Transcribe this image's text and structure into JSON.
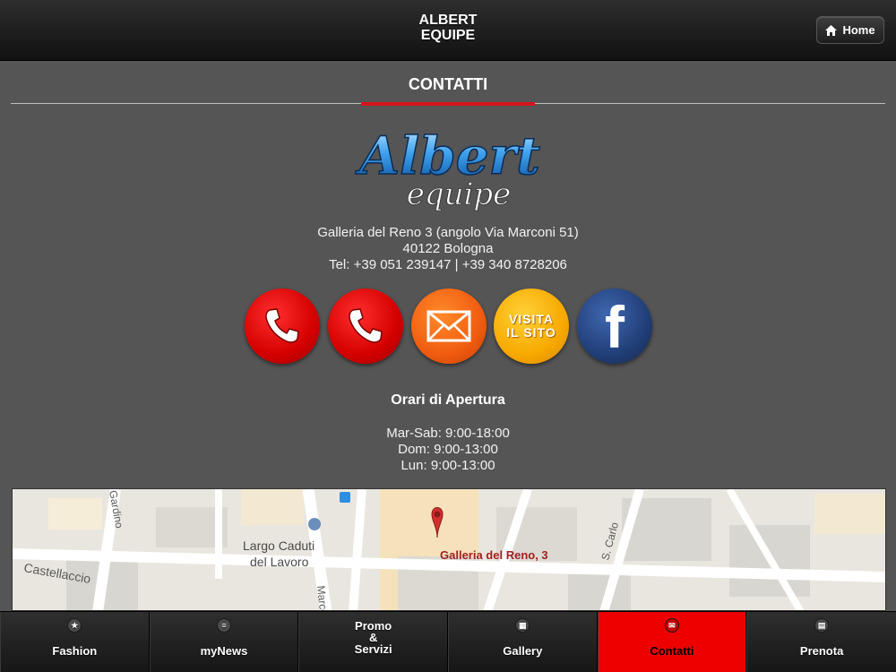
{
  "header": {
    "app_title": "ALBERT\nEQUIPE",
    "home_label": "Home"
  },
  "page": {
    "title": "CONTATTI"
  },
  "logo": {
    "line1": "Albert",
    "line2": "equipe"
  },
  "address": {
    "line1": "Galleria del Reno 3 (angolo Via Marconi 51)",
    "line2": "40122 Bologna",
    "line3": "Tel: +39 051 239147 | +39 340 8728206"
  },
  "actions": {
    "site_label": "VISITA\nIL SITO",
    "facebook_glyph": "f"
  },
  "hours": {
    "title": "Orari di Apertura",
    "line1": "Mar-Sab: 9:00-18:00",
    "line2": "Dom: 9:00-13:00",
    "line3": "Lun: 9:00-13:00"
  },
  "map": {
    "marker_label": "Galleria del Reno, 3",
    "place_label_1": "Largo Caduti",
    "place_label_2": "del Lavoro",
    "street_1": "Gardino",
    "street_2": "Castellaccio",
    "street_3": "S. Carlo",
    "street_4": "Marconi",
    "pin_color": "#d32f2f"
  },
  "nav": {
    "items": [
      {
        "label": "Fashion",
        "icon": "star-icon",
        "glyph": "★"
      },
      {
        "label": "myNews",
        "icon": "list-icon",
        "glyph": "≡"
      },
      {
        "label": "Promo\n&\nServizi",
        "icon": "tag-icon",
        "glyph": ""
      },
      {
        "label": "Gallery",
        "icon": "grid-icon",
        "glyph": "▦"
      },
      {
        "label": "Contatti",
        "icon": "envelope-icon",
        "glyph": "✉"
      },
      {
        "label": "Prenota",
        "icon": "calendar-icon",
        "glyph": "▤"
      }
    ],
    "active_index": 4,
    "active_color": "#ee0000"
  }
}
